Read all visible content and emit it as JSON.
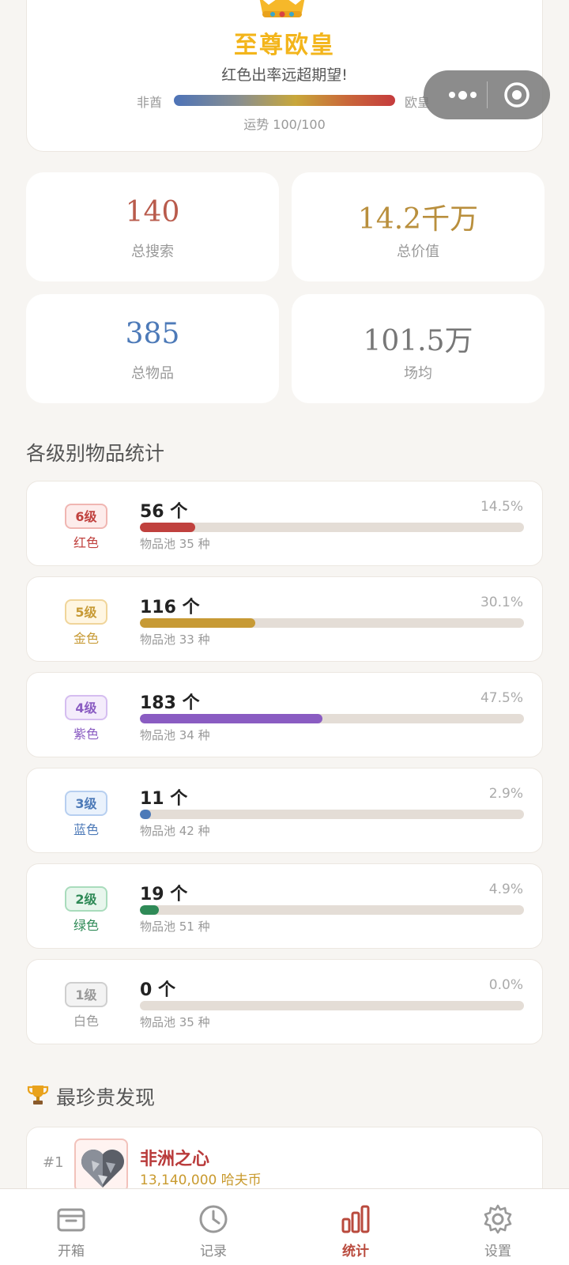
{
  "luck": {
    "rank_title": "至尊欧皇",
    "description": "红色出率远超期望!",
    "left_label": "非酋",
    "right_label": "欧皇",
    "score_text": "运势 100/100",
    "score": 100
  },
  "stats": [
    {
      "value": "140",
      "label": "总搜索"
    },
    {
      "value": "14.2千万",
      "label": "总价值"
    },
    {
      "value": "385",
      "label": "总物品"
    },
    {
      "value": "101.5万",
      "label": "场均"
    }
  ],
  "grade_section_title": "各级别物品统计",
  "grades": [
    {
      "badge": "6级",
      "color_name": "红色",
      "count": "56 个",
      "percent": "14.5%",
      "fraction": 0.145,
      "pool": "物品池 35 种",
      "color": "#c0413e",
      "badge_bg": "#fdeceb",
      "badge_border": "#f0b6b2"
    },
    {
      "badge": "5级",
      "color_name": "金色",
      "count": "116 个",
      "percent": "30.1%",
      "fraction": 0.301,
      "pool": "物品池 33 种",
      "color": "#c79a35",
      "badge_bg": "#fff6e2",
      "badge_border": "#f0d59a"
    },
    {
      "badge": "4级",
      "color_name": "紫色",
      "count": "183 个",
      "percent": "47.5%",
      "fraction": 0.475,
      "pool": "物品池 34 种",
      "color": "#8a5cc2",
      "badge_bg": "#f4ecfb",
      "badge_border": "#d5bdf0"
    },
    {
      "badge": "3级",
      "color_name": "蓝色",
      "count": "11 个",
      "percent": "2.9%",
      "fraction": 0.029,
      "pool": "物品池 42 种",
      "color": "#4d7ab8",
      "badge_bg": "#eaf2fc",
      "badge_border": "#b7cff0"
    },
    {
      "badge": "2级",
      "color_name": "绿色",
      "count": "19 个",
      "percent": "4.9%",
      "fraction": 0.049,
      "pool": "物品池 51 种",
      "color": "#2f8a57",
      "badge_bg": "#e8f6ed",
      "badge_border": "#a9dcbc"
    },
    {
      "badge": "1级",
      "color_name": "白色",
      "count": "0 个",
      "percent": "0.0%",
      "fraction": 0.0,
      "pool": "物品池 35 种",
      "color": "#999999",
      "badge_bg": "#f3f3f3",
      "badge_border": "#cfcfcf"
    }
  ],
  "treasure_section_title": "最珍贵发现",
  "treasures": [
    {
      "rank": "#1",
      "name": "非洲之心",
      "price": "13,140,000 哈夫币"
    }
  ],
  "tabs": [
    {
      "label": "开箱",
      "icon": "box-icon",
      "active": false
    },
    {
      "label": "记录",
      "icon": "clock-icon",
      "active": false
    },
    {
      "label": "统计",
      "icon": "bar-chart-icon",
      "active": true
    },
    {
      "label": "设置",
      "icon": "gear-icon",
      "active": false
    }
  ],
  "colors": {
    "accent": "#b94a3d",
    "gold": "#f3b51b",
    "background": "#f7f5f2"
  }
}
